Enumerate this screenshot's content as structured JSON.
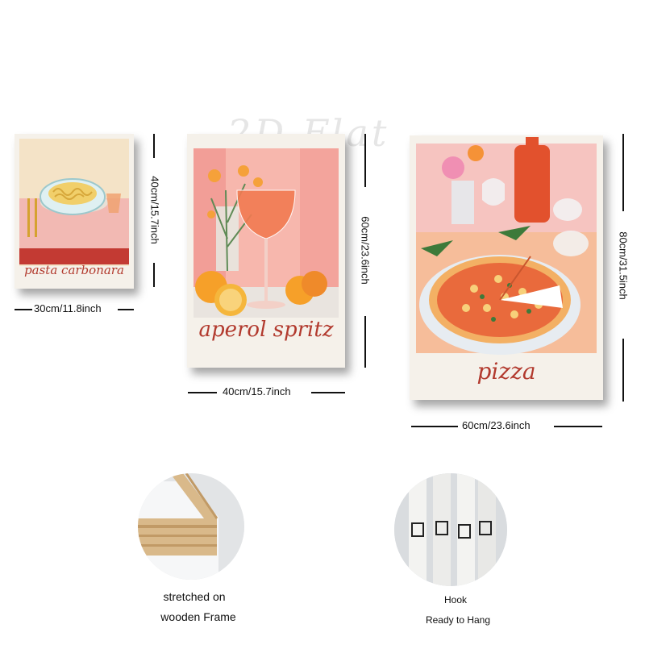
{
  "watermark": "2D Flat",
  "posters": [
    {
      "title": "pasta carbonara",
      "height_label": "40cm/15.7inch",
      "width_label": "30cm/11.8inch"
    },
    {
      "title": "aperol spritz",
      "height_label": "60cm/23.6inch",
      "width_label": "40cm/15.7inch"
    },
    {
      "title": "pizza",
      "height_label": "80cm/31.5inch",
      "width_label": "60cm/23.6inch"
    }
  ],
  "features": [
    {
      "line1": "stretched on",
      "line2": "wooden Frame"
    },
    {
      "line1": "Hook",
      "line2": "Ready to Hang"
    }
  ]
}
